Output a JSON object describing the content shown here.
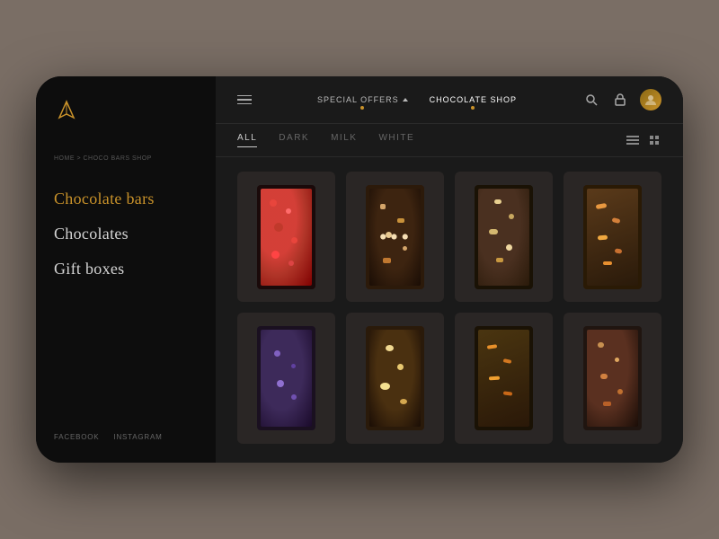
{
  "device": {
    "type": "laptop"
  },
  "sidebar": {
    "logo_alt": "Brand Logo",
    "breadcrumb": "HOME > CHOCO BARS SHOP",
    "nav_items": [
      {
        "label": "Chocolate bars",
        "active": true,
        "id": "chocolate-bars"
      },
      {
        "label": "Chocolates",
        "active": false,
        "id": "chocolates"
      },
      {
        "label": "Gift boxes",
        "active": false,
        "id": "gift-boxes"
      }
    ],
    "social_links": [
      {
        "label": "FACEBOOK",
        "id": "facebook"
      },
      {
        "label": "INSTAGRAM",
        "id": "instagram"
      }
    ]
  },
  "topnav": {
    "menu_label": "menu",
    "links": [
      {
        "label": "SPECIAL OFFERS",
        "has_dropdown": true,
        "active": false
      },
      {
        "label": "CHOCOLATE SHOP",
        "has_dropdown": false,
        "active": true
      }
    ],
    "icons": {
      "search": "search",
      "lock": "lock",
      "avatar": "user-avatar"
    }
  },
  "filters": {
    "tabs": [
      {
        "label": "ALL",
        "active": true
      },
      {
        "label": "DARK",
        "active": false
      },
      {
        "label": "MILK",
        "active": false
      },
      {
        "label": "WHITE",
        "active": false
      }
    ],
    "views": [
      "list",
      "grid"
    ]
  },
  "products": {
    "rows": [
      [
        {
          "id": 1,
          "type": "strawberry",
          "variant": "choc-bar-1"
        },
        {
          "id": 2,
          "type": "nuts-dark",
          "variant": "choc-bar-2"
        },
        {
          "id": 3,
          "type": "mixed-nuts",
          "variant": "choc-bar-3"
        },
        {
          "id": 4,
          "type": "dried-fruits",
          "variant": "choc-bar-4"
        }
      ],
      [
        {
          "id": 5,
          "type": "berry-dark",
          "variant": "choc-bar-5"
        },
        {
          "id": 6,
          "type": "almond",
          "variant": "choc-bar-6"
        },
        {
          "id": 7,
          "type": "orange-peel",
          "variant": "choc-bar-7"
        },
        {
          "id": 8,
          "type": "mixed-dark",
          "variant": "choc-bar-8"
        }
      ]
    ]
  },
  "colors": {
    "accent": "#c9922a",
    "sidebar_bg": "#0d0d0d",
    "main_bg": "#1a1a1a",
    "text_primary": "#d4d4d4",
    "text_muted": "#666"
  }
}
